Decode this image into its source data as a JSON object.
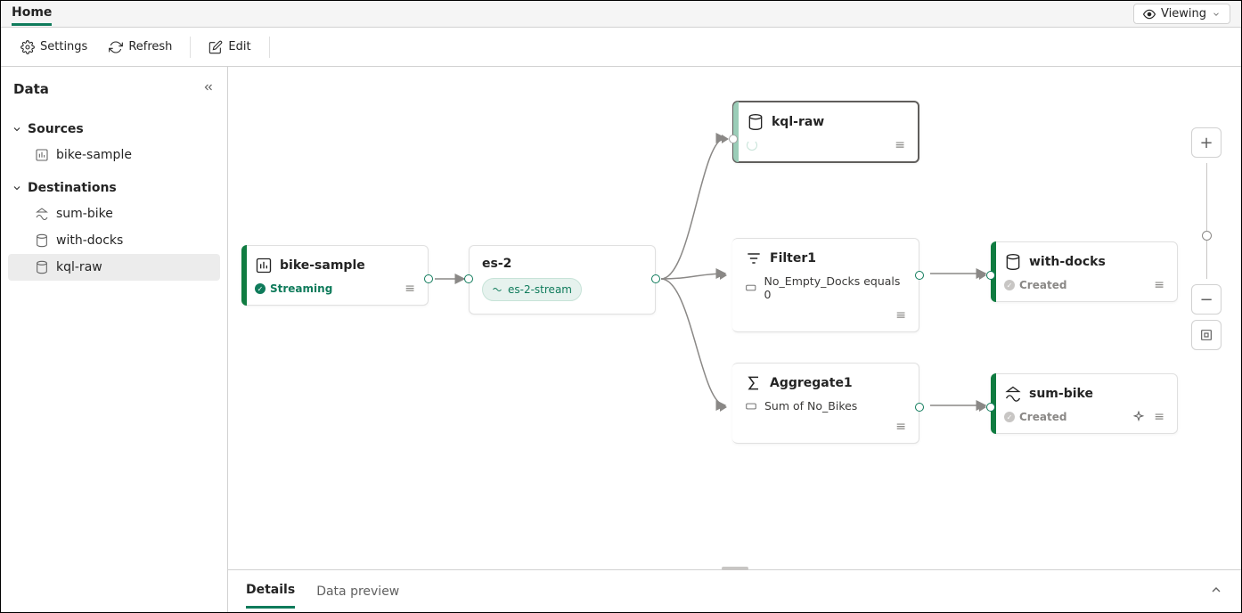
{
  "header": {
    "tab": "Home",
    "mode": "Viewing"
  },
  "toolbar": {
    "settings": "Settings",
    "refresh": "Refresh",
    "edit": "Edit"
  },
  "sidepanel": {
    "title": "Data",
    "sections": {
      "sources": {
        "label": "Sources",
        "items": [
          {
            "label": "bike-sample",
            "icon": "chart-icon"
          }
        ]
      },
      "destinations": {
        "label": "Destinations",
        "items": [
          {
            "label": "sum-bike",
            "icon": "lakehouse-icon"
          },
          {
            "label": "with-docks",
            "icon": "database-icon"
          },
          {
            "label": "kql-raw",
            "icon": "database-icon",
            "selected": true
          }
        ]
      }
    }
  },
  "canvas": {
    "nodes": {
      "bike_sample": {
        "title": "bike-sample",
        "status": "Streaming"
      },
      "es2": {
        "title": "es-2",
        "stream_label": "es-2-stream"
      },
      "kql_raw": {
        "title": "kql-raw"
      },
      "filter1": {
        "title": "Filter1",
        "condition": "No_Empty_Docks equals 0"
      },
      "aggregate1": {
        "title": "Aggregate1",
        "expr": "Sum of No_Bikes"
      },
      "with_docks": {
        "title": "with-docks",
        "status": "Created"
      },
      "sum_bike": {
        "title": "sum-bike",
        "status": "Created"
      }
    }
  },
  "bottom": {
    "tabs": {
      "details": "Details",
      "data_preview": "Data preview"
    }
  }
}
